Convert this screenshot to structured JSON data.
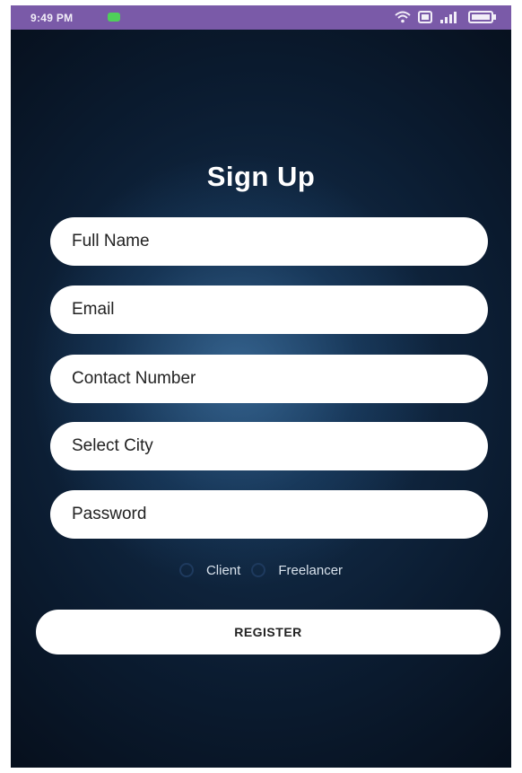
{
  "status_bar": {
    "time": "9:49 PM",
    "icons": [
      "wifi-icon",
      "notification-icon",
      "signal-icon",
      "battery-icon"
    ]
  },
  "title": "Sign Up",
  "fields": {
    "full_name": "Full Name",
    "email": "Email",
    "contact_number": "Contact Number",
    "select_city": "Select City",
    "password": "Password"
  },
  "roles": {
    "client": "Client",
    "freelancer": "Freelancer"
  },
  "register_label": "REGISTER",
  "colors": {
    "status_bar": "#7a5aa8",
    "background_dark": "#0b1c31",
    "background_glow": "#467daf",
    "field_bg": "#ffffff"
  }
}
